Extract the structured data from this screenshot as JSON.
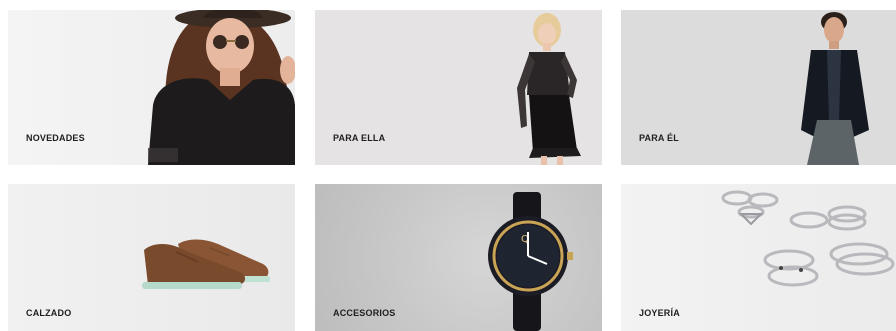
{
  "categories": [
    {
      "label": "NOVEDADES",
      "image": "woman-hat-sunglasses-black-top"
    },
    {
      "label": "PARA ELLA",
      "image": "woman-black-dress"
    },
    {
      "label": "PARA ÉL",
      "image": "man-leather-jacket"
    },
    {
      "label": "CALZADO",
      "image": "brown-suede-sneakers"
    },
    {
      "label": "ACCESORIOS",
      "image": "black-gold-wristwatch"
    },
    {
      "label": "JOYERÍA",
      "image": "silver-rings"
    }
  ],
  "colors": {
    "label": "#1e1e1e",
    "tile_background": "#e6e6e6"
  }
}
